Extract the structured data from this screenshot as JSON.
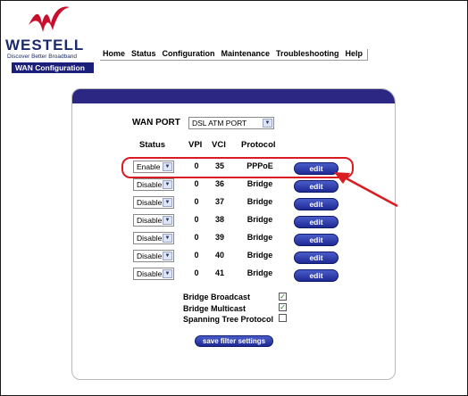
{
  "brand": {
    "name": "WESTELL",
    "tagline": "Discover Better Broadband"
  },
  "nav": {
    "items": [
      "Home",
      "Status",
      "Configuration",
      "Maintenance",
      "Troubleshooting",
      "Help"
    ]
  },
  "page_badge": "WAN Configuration",
  "wan_port": {
    "label": "WAN PORT",
    "value": "DSL ATM PORT"
  },
  "table": {
    "headers": {
      "status": "Status",
      "vpi": "VPI",
      "vci": "VCI",
      "protocol": "Protocol"
    },
    "rows": [
      {
        "status": "Enable",
        "vpi": "0",
        "vci": "35",
        "protocol": "PPPoE",
        "action": "edit"
      },
      {
        "status": "Disable",
        "vpi": "0",
        "vci": "36",
        "protocol": "Bridge",
        "action": "edit"
      },
      {
        "status": "Disable",
        "vpi": "0",
        "vci": "37",
        "protocol": "Bridge",
        "action": "edit"
      },
      {
        "status": "Disable",
        "vpi": "0",
        "vci": "38",
        "protocol": "Bridge",
        "action": "edit"
      },
      {
        "status": "Disable",
        "vpi": "0",
        "vci": "39",
        "protocol": "Bridge",
        "action": "edit"
      },
      {
        "status": "Disable",
        "vpi": "0",
        "vci": "40",
        "protocol": "Bridge",
        "action": "edit"
      },
      {
        "status": "Disable",
        "vpi": "0",
        "vci": "41",
        "protocol": "Bridge",
        "action": "edit"
      }
    ]
  },
  "options": [
    {
      "label": "Bridge Broadcast",
      "checked": true
    },
    {
      "label": "Bridge Multicast",
      "checked": true
    },
    {
      "label": "Spanning Tree Protocol",
      "checked": false
    }
  ],
  "save_button": "save filter settings",
  "colors": {
    "brand_navy": "#1c2a6b",
    "panel_header": "#2b2782",
    "button_blue": "#1e2a96",
    "annotation_red": "#d81c22",
    "logo_red": "#c8102e"
  }
}
